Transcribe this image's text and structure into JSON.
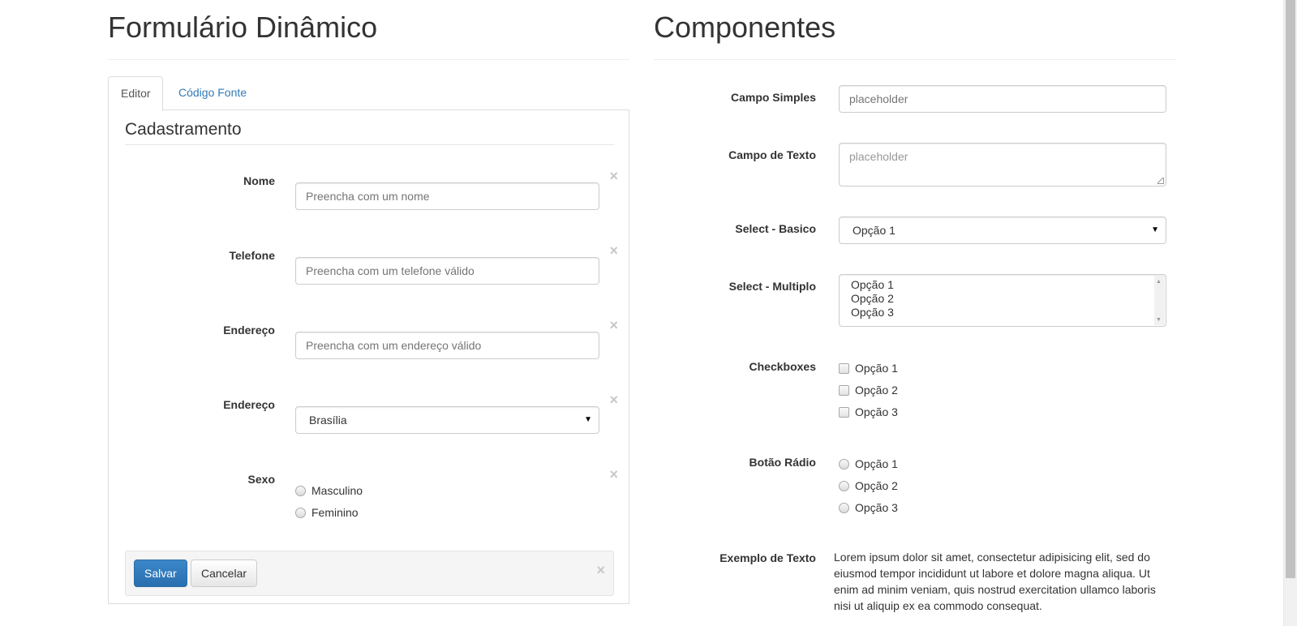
{
  "editor": {
    "title": "Formulário Dinâmico",
    "tabs": [
      {
        "label": "Editor",
        "active": true
      },
      {
        "label": "Código Fonte",
        "active": false
      }
    ],
    "legend": "Cadastramento",
    "fields": [
      {
        "label": "Nome",
        "type": "text",
        "placeholder": "Preencha com um nome"
      },
      {
        "label": "Telefone",
        "type": "text",
        "placeholder": "Preencha com um telefone válido"
      },
      {
        "label": "Endereço",
        "type": "text",
        "placeholder": "Preencha com um endereço válido"
      },
      {
        "label": "Endereço",
        "type": "select",
        "value": "Brasília"
      },
      {
        "label": "Sexo",
        "type": "radio",
        "options": [
          "Masculino",
          "Feminino"
        ]
      }
    ],
    "close_glyph": "×",
    "actions": {
      "save": "Salvar",
      "cancel": "Cancelar"
    }
  },
  "components": {
    "title": "Componentes",
    "campo_simples": {
      "label": "Campo Simples",
      "placeholder": "placeholder"
    },
    "campo_texto": {
      "label": "Campo de Texto",
      "placeholder": "placeholder"
    },
    "select_basico": {
      "label": "Select - Basico",
      "value": "Opção 1"
    },
    "select_multiplo": {
      "label": "Select - Multiplo",
      "options": [
        "Opção 1",
        "Opção 2",
        "Opção 3"
      ]
    },
    "checkboxes": {
      "label": "Checkboxes",
      "options": [
        "Opção 1",
        "Opção 2",
        "Opção 3"
      ]
    },
    "radio": {
      "label": "Botão Rádio",
      "options": [
        "Opção 1",
        "Opção 2",
        "Opção 3"
      ]
    },
    "texto": {
      "label": "Exemplo de Texto",
      "content": "Lorem ipsum dolor sit amet, consectetur adipisicing elit, sed do eiusmod tempor incididunt ut labore et dolore magna aliqua. Ut enim ad minim veniam, quis nostrud exercitation ullamco laboris nisi ut aliquip ex ea commodo consequat."
    }
  },
  "colors": {
    "link": "#337ab7",
    "primary": "#2e6da4",
    "border": "#cccccc"
  },
  "icons": [
    "close-icon",
    "chevron-down-icon"
  ]
}
